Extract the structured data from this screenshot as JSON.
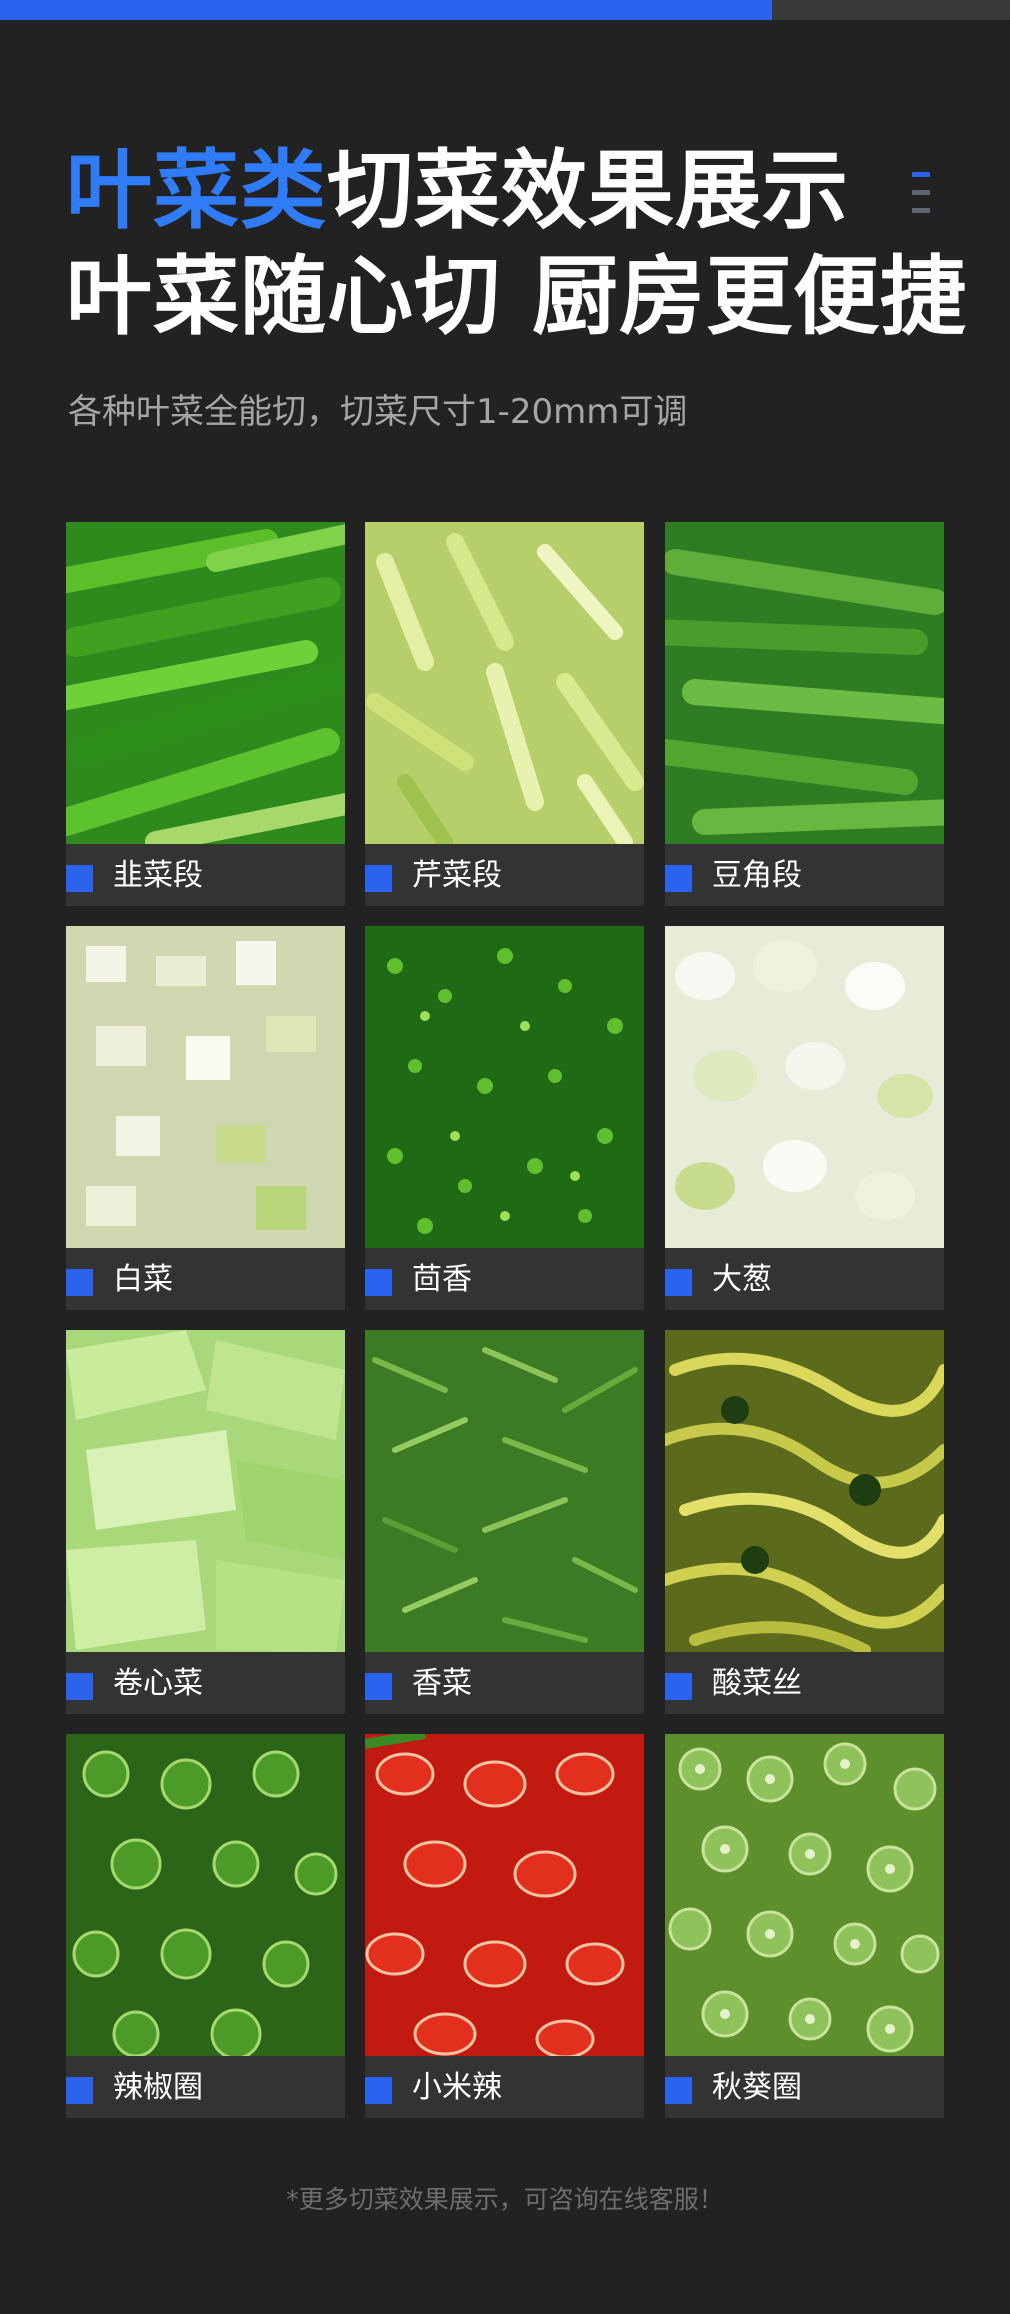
{
  "progress": {
    "fraction": 0.764
  },
  "header": {
    "title_accent": "叶菜类",
    "title_rest": "切菜效果展示",
    "title_line2": "叶菜随心切 厨房更便捷",
    "subtitle": "各种叶菜全能切，切菜尺寸1-20mm可调",
    "menu_icon": "menu-icon"
  },
  "colors": {
    "accent": "#2f7cf6",
    "label_square": "#2b62ee",
    "background": "#222222",
    "label_bar": "#333333"
  },
  "items": [
    {
      "label": "韭菜段",
      "photo": "chopped-chives-photo"
    },
    {
      "label": "芹菜段",
      "photo": "chopped-celery-photo"
    },
    {
      "label": "豆角段",
      "photo": "green-bean-pieces-photo"
    },
    {
      "label": "白菜",
      "photo": "chopped-cabbage-photo"
    },
    {
      "label": "茴香",
      "photo": "chopped-fennel-photo"
    },
    {
      "label": "大葱",
      "photo": "scallion-rings-photo"
    },
    {
      "label": "卷心菜",
      "photo": "cabbage-strips-photo"
    },
    {
      "label": "香菜",
      "photo": "chopped-cilantro-photo"
    },
    {
      "label": "酸菜丝",
      "photo": "pickled-cabbage-shreds-photo"
    },
    {
      "label": "辣椒圈",
      "photo": "green-pepper-rings-photo"
    },
    {
      "label": "小米辣",
      "photo": "red-chili-rings-photo"
    },
    {
      "label": "秋葵圈",
      "photo": "okra-slices-photo"
    }
  ],
  "footnote": "*更多切菜效果展示，可咨询在线客服！"
}
